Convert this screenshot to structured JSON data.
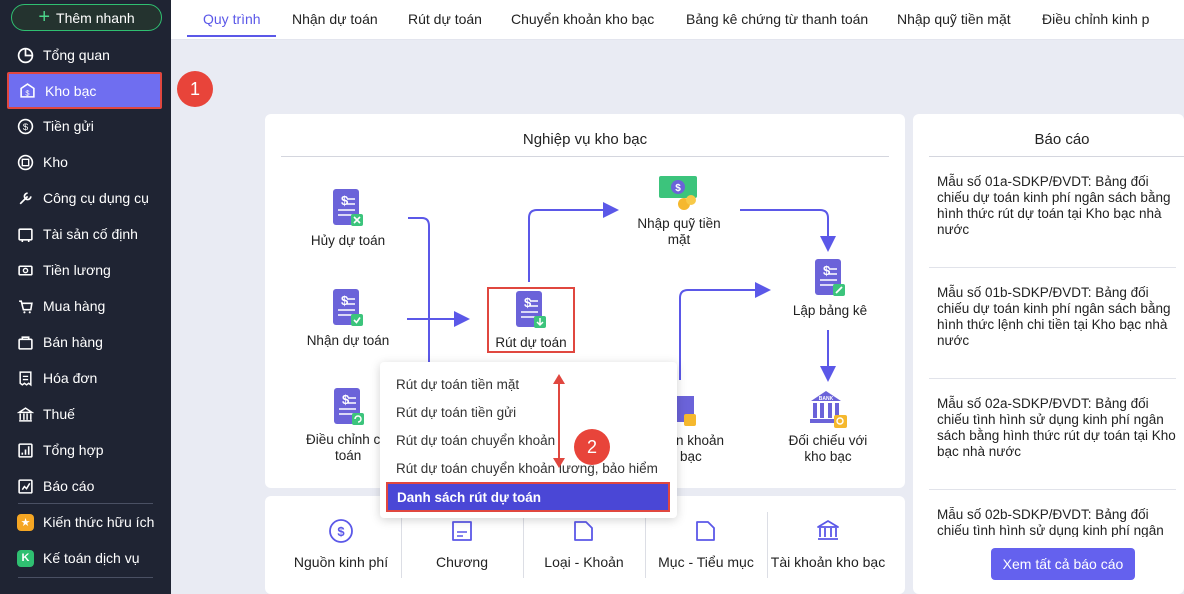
{
  "sidebar": {
    "add_label": "Thêm nhanh",
    "items": [
      {
        "label": "Tổng quan",
        "icon": "dashboard-icon"
      },
      {
        "label": "Kho bạc",
        "icon": "treasury-icon"
      },
      {
        "label": "Tiền gửi",
        "icon": "deposit-icon"
      },
      {
        "label": "Kho",
        "icon": "warehouse-icon"
      },
      {
        "label": "Công cụ dụng cụ",
        "icon": "tools-icon"
      },
      {
        "label": "Tài sản cố định",
        "icon": "asset-icon"
      },
      {
        "label": "Tiền lương",
        "icon": "salary-icon"
      },
      {
        "label": "Mua hàng",
        "icon": "purchase-icon"
      },
      {
        "label": "Bán hàng",
        "icon": "sales-icon"
      },
      {
        "label": "Hóa đơn",
        "icon": "invoice-icon"
      },
      {
        "label": "Thuế",
        "icon": "tax-icon"
      },
      {
        "label": "Tổng hợp",
        "icon": "summary-icon"
      },
      {
        "label": "Báo cáo",
        "icon": "report-icon"
      },
      {
        "label": "Kiến thức hữu ích",
        "icon": "knowledge-icon"
      },
      {
        "label": "Kế toán dịch vụ",
        "icon": "service-accounting-icon"
      }
    ],
    "active_index": 1
  },
  "steps": {
    "one": "1",
    "two": "2"
  },
  "tabs": [
    "Quy trình",
    "Nhận dự toán",
    "Rút dự toán",
    "Chuyển khoản kho bạc",
    "Bảng kê chứng từ thanh toán",
    "Nhập quỹ tiền mặt",
    "Điều chỉnh kinh p"
  ],
  "workflow": {
    "title": "Nghiệp vụ kho bạc",
    "nodes": {
      "huy": "Hủy dự toán",
      "nhan": "Nhận dự toán",
      "dieu_chinh_1": "Điều chỉnh c",
      "dieu_chinh_2": "toán",
      "rut": "Rút dự toán",
      "nhap_quy_1": "Nhập quỹ tiền",
      "nhap_quy_2": "mặt",
      "lap_bang_ke": "Lập bảng kê",
      "chuyen_khoan_1": "n khoản",
      "chuyen_khoan_2": "bạc",
      "doi_chieu_1": "Đối chiếu với",
      "doi_chieu_2": "kho bạc"
    }
  },
  "dropdown": {
    "items": [
      "Rút dự toán tiền mặt",
      "Rút dự toán tiền gửi",
      "Rút dự toán chuyển khoản",
      "Rút dự toán chuyển khoản lương, bảo hiểm"
    ],
    "selected": "Danh sách rút dự toán"
  },
  "categories": [
    {
      "label": "Nguồn kinh phí",
      "icon": "dollar-circle-icon"
    },
    {
      "label": "Chương",
      "icon": "chapter-icon"
    },
    {
      "label": "Loại - Khoản",
      "icon": "folder-icon"
    },
    {
      "label": "Mục - Tiểu mục",
      "icon": "folder-icon"
    },
    {
      "label": "Tài khoản kho bạc",
      "icon": "bank-icon"
    }
  ],
  "reports": {
    "title": "Báo cáo",
    "items": [
      "Mẫu số 01a-SDKP/ĐVDT: Bảng đối chiếu dự toán kinh phí ngân sách bằng hình thức rút dự toán tại Kho bạc nhà nước",
      "Mẫu số 01b-SDKP/ĐVDT: Bảng đối chiếu dự toán kinh phí ngân sách bằng hình thức lệnh chi tiền tại Kho bạc nhà nước",
      "Mẫu số 02a-SDKP/ĐVDT: Bảng đối chiếu tình hình sử dụng kinh phí ngân sách bằng hình thức rút dự toán tại Kho bạc nhà nước",
      "Mẫu số 02b-SDKP/ĐVDT: Bảng đối chiếu tình hình sử dụng kinh phí ngân"
    ],
    "view_all": "Xem tất cả báo cáo"
  },
  "colors": {
    "accent": "#6461ee",
    "sidebar": "#1f2433",
    "highlight": "#e0473f"
  }
}
